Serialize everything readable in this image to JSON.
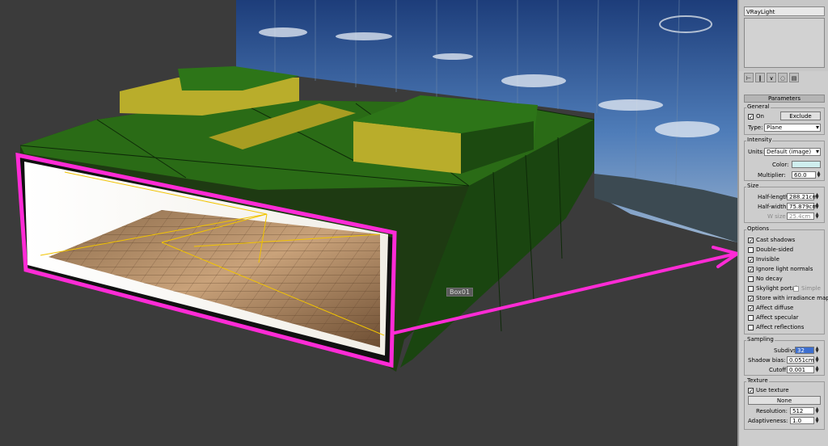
{
  "viewport": {
    "object_label": "Box01"
  },
  "panel": {
    "object_name": "VRayLight",
    "rollout_title": "Parameters",
    "general": {
      "title": "General",
      "on_label": "On",
      "on_checked": true,
      "exclude_label": "Exclude",
      "type_label": "Type:",
      "type_value": "Plane"
    },
    "intensity": {
      "title": "Intensity",
      "units_label": "Units:",
      "units_value": "Default (image)",
      "color_label": "Color:",
      "color_value": "#cfeeee",
      "multiplier_label": "Multiplier:",
      "multiplier_value": "60.0"
    },
    "size": {
      "title": "Size",
      "half_length_label": "Half-length:",
      "half_length_value": "288.21cm",
      "half_width_label": "Half-width:",
      "half_width_value": "75.879cm",
      "w_size_label": "W size",
      "w_size_value": "25.4cm"
    },
    "options": {
      "title": "Options",
      "items": [
        {
          "label": "Cast shadows",
          "checked": "✓"
        },
        {
          "label": "Double-sided",
          "checked": ""
        },
        {
          "label": "Invisible",
          "checked": "✓"
        },
        {
          "label": "Ignore light normals",
          "checked": "✓"
        },
        {
          "label": "No decay",
          "checked": ""
        },
        {
          "label": "Skylight portal",
          "checked": ""
        },
        {
          "label": "Store with irradiance map",
          "checked": "✓"
        },
        {
          "label": "Affect diffuse",
          "checked": "✓"
        },
        {
          "label": "Affect specular",
          "checked": ""
        },
        {
          "label": "Affect reflections",
          "checked": ""
        }
      ],
      "simple_label": "Simple"
    },
    "sampling": {
      "title": "Sampling",
      "subdivs_label": "Subdivs:",
      "subdivs_value": "32",
      "shadow_bias_label": "Shadow bias:",
      "shadow_bias_value": "0.051cm",
      "cutoff_label": "Cutoff:",
      "cutoff_value": "0.001"
    },
    "texture": {
      "title": "Texture",
      "use_texture_label": "Use texture",
      "use_texture_checked": "✓",
      "map_button_label": "None",
      "resolution_label": "Resolution:",
      "resolution_value": "512",
      "adaptiveness_label": "Adaptiveness:",
      "adaptiveness_value": "1.0"
    }
  }
}
